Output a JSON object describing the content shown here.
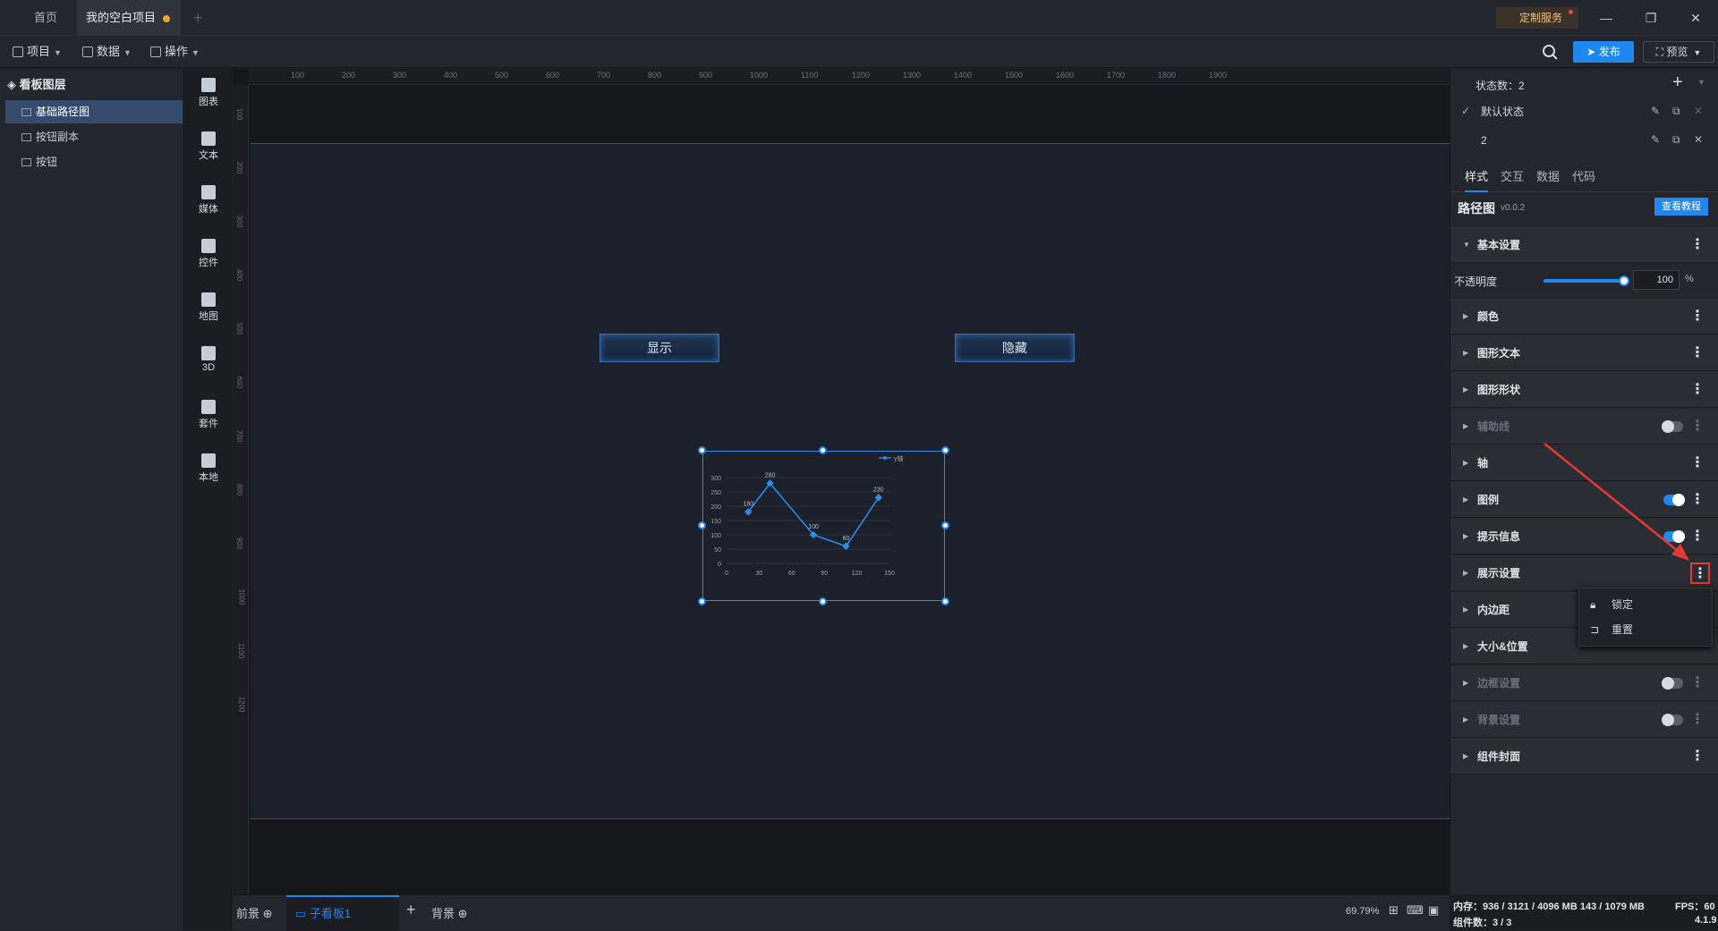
{
  "titlebar": {
    "tabs": [
      "首页",
      "我的空白项目"
    ],
    "custom_service": "定制服务"
  },
  "toolbar": {
    "menus": [
      "项目",
      "数据",
      "操作"
    ],
    "publish": "发布",
    "preview": "预览"
  },
  "layers": {
    "title": "看板图层",
    "items": [
      "基础路径图",
      "按钮副本",
      "按钮"
    ]
  },
  "iconbar": [
    "图表",
    "文本",
    "媒体",
    "控件",
    "地图",
    "3D",
    "套件",
    "本地"
  ],
  "canvas": {
    "ruler_h": [
      "100",
      "200",
      "300",
      "400",
      "500",
      "600",
      "700",
      "800",
      "900",
      "1000",
      "1100",
      "1200",
      "1300",
      "1400",
      "1500",
      "1600",
      "1700",
      "1800",
      "1900"
    ],
    "ruler_v": [
      "100",
      "200",
      "300",
      "400",
      "500",
      "600",
      "700",
      "800",
      "900",
      "1000",
      "1100",
      "1200"
    ],
    "show_button": "显示",
    "hide_button": "隐藏"
  },
  "chart_data": {
    "type": "line",
    "legend": "y轴",
    "x": [
      20,
      40,
      80,
      110,
      140
    ],
    "y": [
      180,
      280,
      100,
      60,
      230
    ],
    "data_labels": [
      "180",
      "280",
      "100",
      "60",
      "230"
    ],
    "xticks": [
      "0",
      "30",
      "60",
      "90",
      "120",
      "150"
    ],
    "yticks": [
      "0",
      "50",
      "100",
      "150",
      "200",
      "250",
      "300"
    ],
    "xlim": [
      0,
      150
    ],
    "ylim": [
      0,
      300
    ],
    "color": "#2b8be6"
  },
  "bottombar": {
    "foreground": "前景",
    "sub_board": "子看板1",
    "background": "背景",
    "zoom": "69.79%"
  },
  "right_panel": {
    "state_count": "状态数：2",
    "states": [
      "默认状态",
      "2"
    ],
    "tabs": [
      "样式",
      "交互",
      "数据",
      "代码"
    ],
    "component_name": "路径图",
    "version": "v0.0.2",
    "tutorial": "查看教程",
    "opacity_label": "不透明度",
    "opacity_value": "100",
    "opacity_unit": "%",
    "opacity_fraction": 1.0,
    "sections": {
      "basic": "基本设置",
      "color": "颜色",
      "shape_text": "图形文本",
      "shape": "图形形状",
      "guide": "辅助线",
      "axis": "轴",
      "legend": "图例",
      "tooltip": "提示信息",
      "display": "展示设置",
      "padding": "内边距",
      "size_pos": "大小&位置",
      "border": "边框设置",
      "bg": "背景设置",
      "cover": "组件封面"
    },
    "context_menu": [
      "锁定",
      "重置"
    ]
  },
  "status": {
    "memory": "内存：936 / 3121 / 4096 MB  143 / 1079 MB",
    "fps": "FPS：60",
    "components": "组件数：3 / 3",
    "version": "4.1.9"
  },
  "colors": {
    "accent": "#1e87f0",
    "annotation": "#e53935"
  }
}
